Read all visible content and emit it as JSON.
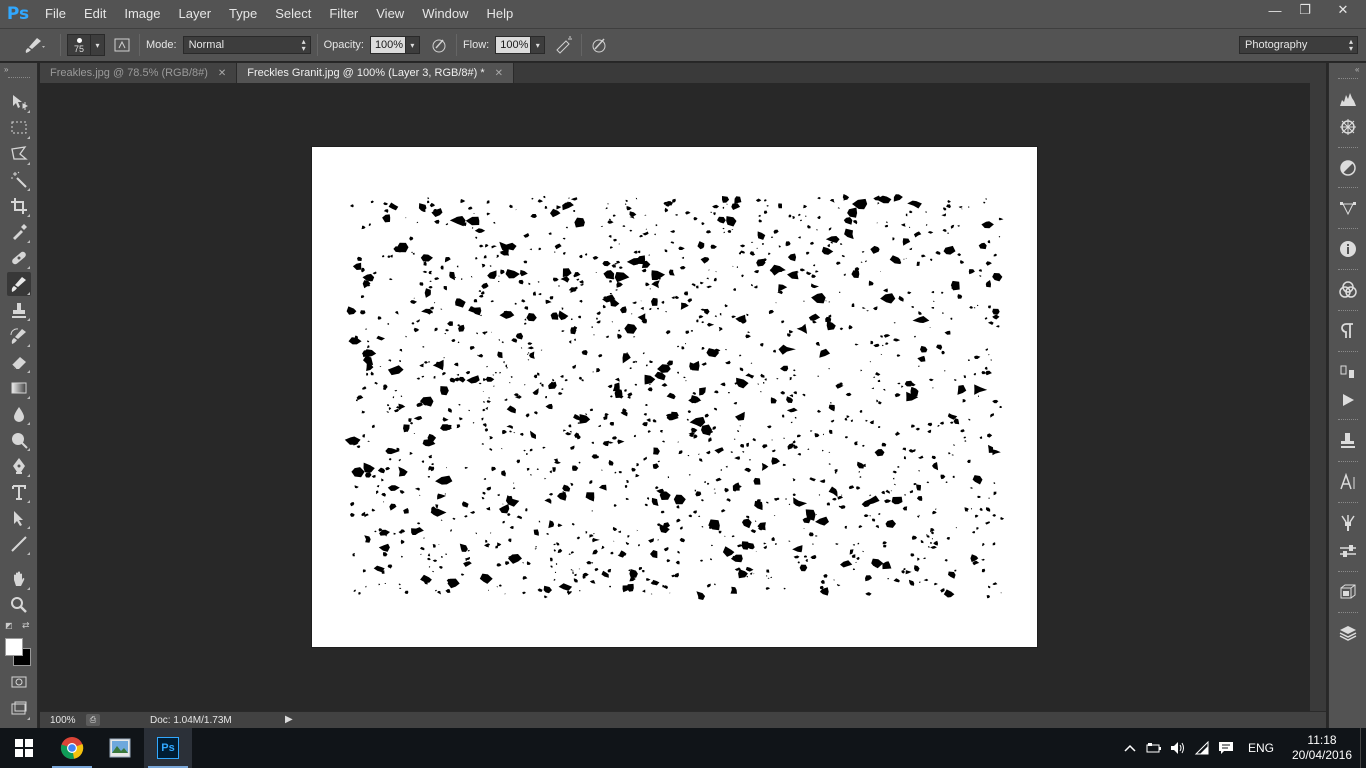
{
  "app": {
    "logo": "Ps"
  },
  "menu": [
    "File",
    "Edit",
    "Image",
    "Layer",
    "Type",
    "Select",
    "Filter",
    "View",
    "Window",
    "Help"
  ],
  "window_controls": {
    "minimize": "—",
    "restore": "❐",
    "close": "✕"
  },
  "options": {
    "brush_size": "75",
    "mode_label": "Mode:",
    "mode_value": "Normal",
    "opacity_label": "Opacity:",
    "opacity_value": "100%",
    "flow_label": "Flow:",
    "flow_value": "100%",
    "workspace": "Photography"
  },
  "tabs": [
    {
      "title": "Freakles.jpg @ 78.5% (RGB/8#)",
      "close": "✕",
      "active": false
    },
    {
      "title": "Freckles Granit.jpg @ 100% (Layer 3, RGB/8#) *",
      "close": "✕",
      "active": true
    }
  ],
  "tools": [
    "move-tool-icon",
    "marquee-tool-icon",
    "lasso-tool-icon",
    "magic-wand-tool-icon",
    "crop-tool-icon",
    "eyedropper-tool-icon",
    "healing-brush-tool-icon",
    "brush-tool-icon",
    "clone-stamp-tool-icon",
    "history-brush-tool-icon",
    "eraser-tool-icon",
    "gradient-tool-icon",
    "blur-tool-icon",
    "dodge-tool-icon",
    "pen-tool-icon",
    "type-tool-icon",
    "path-selection-tool-icon",
    "line-tool-icon",
    "hand-tool-icon",
    "zoom-tool-icon"
  ],
  "colors": {
    "foreground": "#ffffff",
    "background": "#000000",
    "accent": "#31a8ff"
  },
  "status": {
    "zoom": "100%",
    "doc": "Doc: 1.04M/1.73M"
  },
  "taskbar": {
    "lang": "ENG",
    "time": "11:18",
    "date": "20/04/2016"
  }
}
